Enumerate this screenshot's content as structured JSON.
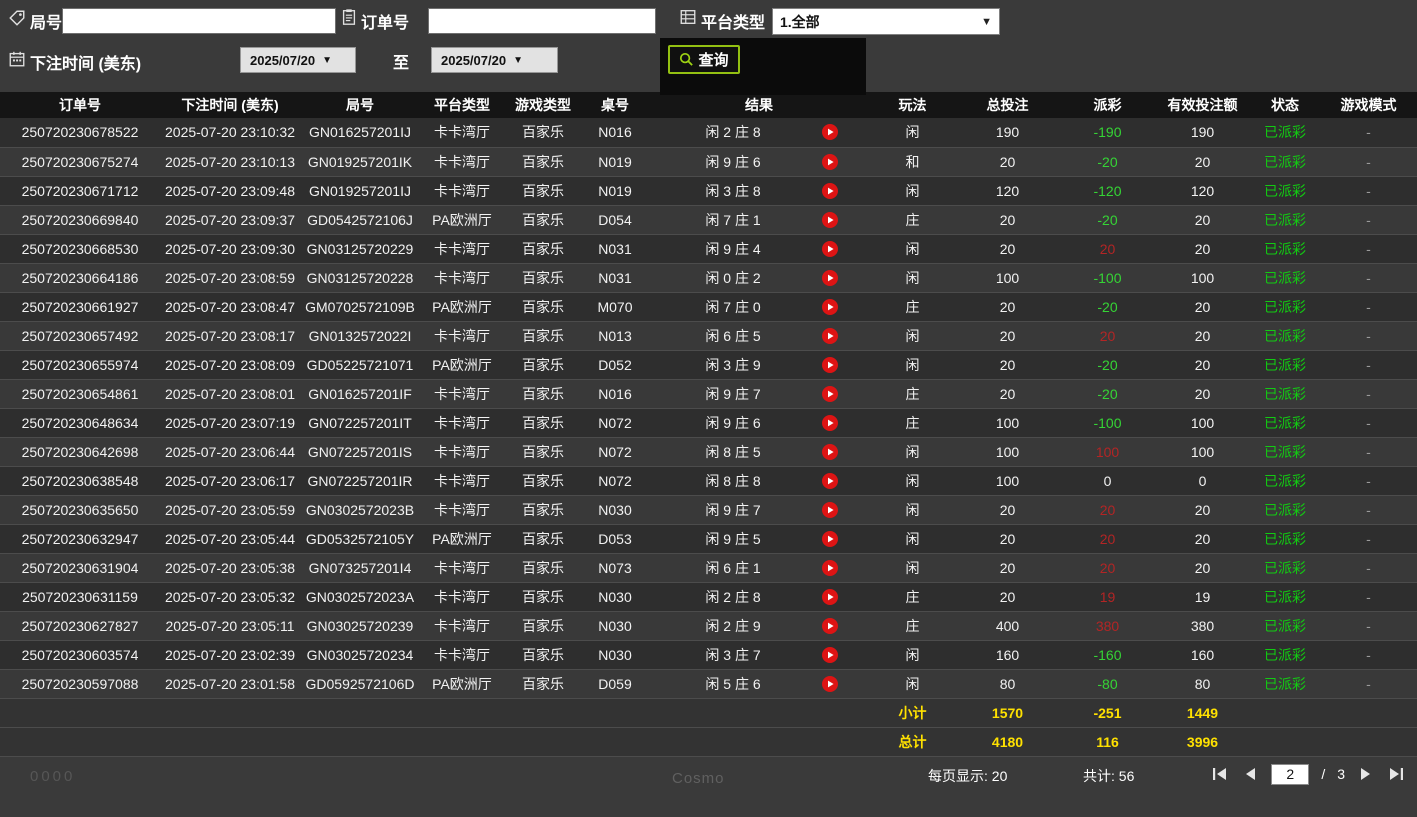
{
  "colors": {
    "background": "#3a3a3a",
    "table_header_bg": "#151515",
    "negative_payout": "#35d435",
    "positive_payout": "#b32525",
    "status_paid": "#12cb12",
    "summary_text": "#ffe100",
    "query_border": "#93c012",
    "play_icon": "#dd1414"
  },
  "filters": {
    "round": {
      "label": "局号",
      "value": "",
      "icon": "tag-icon"
    },
    "order": {
      "label": "订单号",
      "value": "",
      "icon": "clipboard-icon"
    },
    "platform": {
      "label": "平台类型",
      "value": "1.全部",
      "icon": "grid-icon"
    },
    "bet_time": {
      "label": "下注时间 (美东)",
      "icon": "calendar-icon"
    },
    "date_from": "2025/07/20",
    "to_label": "至",
    "date_to": "2025/07/20",
    "query_button": "查询"
  },
  "table": {
    "headers": [
      "订单号",
      "下注时间 (美东)",
      "局号",
      "平台类型",
      "游戏类型",
      "桌号",
      "结果",
      "玩法",
      "总投注",
      "派彩",
      "有效投注额",
      "状态",
      "游戏模式"
    ],
    "rows": [
      {
        "order": "250720230678522",
        "time": "2025-07-20 23:10:32",
        "round": "GN016257201IJ",
        "platform": "卡卡湾厅",
        "game": "百家乐",
        "table_no": "N016",
        "result": "闲 2 庄 8",
        "play": "闲",
        "total": "190",
        "payout": "-190",
        "payout_tone": "neg",
        "valid": "190",
        "status": "已派彩",
        "mode": "-"
      },
      {
        "order": "250720230675274",
        "time": "2025-07-20 23:10:13",
        "round": "GN019257201IK",
        "platform": "卡卡湾厅",
        "game": "百家乐",
        "table_no": "N019",
        "result": "闲 9 庄 6",
        "play": "和",
        "total": "20",
        "payout": "-20",
        "payout_tone": "neg",
        "valid": "20",
        "status": "已派彩",
        "mode": "-"
      },
      {
        "order": "250720230671712",
        "time": "2025-07-20 23:09:48",
        "round": "GN019257201IJ",
        "platform": "卡卡湾厅",
        "game": "百家乐",
        "table_no": "N019",
        "result": "闲 3 庄 8",
        "play": "闲",
        "total": "120",
        "payout": "-120",
        "payout_tone": "neg",
        "valid": "120",
        "status": "已派彩",
        "mode": "-"
      },
      {
        "order": "250720230669840",
        "time": "2025-07-20 23:09:37",
        "round": "GD0542572106J",
        "platform": "PA欧洲厅",
        "game": "百家乐",
        "table_no": "D054",
        "result": "闲 7 庄 1",
        "play": "庄",
        "total": "20",
        "payout": "-20",
        "payout_tone": "neg",
        "valid": "20",
        "status": "已派彩",
        "mode": "-"
      },
      {
        "order": "250720230668530",
        "time": "2025-07-20 23:09:30",
        "round": "GN03125720229",
        "platform": "卡卡湾厅",
        "game": "百家乐",
        "table_no": "N031",
        "result": "闲 9 庄 4",
        "play": "闲",
        "total": "20",
        "payout": "20",
        "payout_tone": "pos",
        "valid": "20",
        "status": "已派彩",
        "mode": "-"
      },
      {
        "order": "250720230664186",
        "time": "2025-07-20 23:08:59",
        "round": "GN03125720228",
        "platform": "卡卡湾厅",
        "game": "百家乐",
        "table_no": "N031",
        "result": "闲 0 庄 2",
        "play": "闲",
        "total": "100",
        "payout": "-100",
        "payout_tone": "neg",
        "valid": "100",
        "status": "已派彩",
        "mode": "-"
      },
      {
        "order": "250720230661927",
        "time": "2025-07-20 23:08:47",
        "round": "GM0702572109B",
        "platform": "PA欧洲厅",
        "game": "百家乐",
        "table_no": "M070",
        "result": "闲 7 庄 0",
        "play": "庄",
        "total": "20",
        "payout": "-20",
        "payout_tone": "neg",
        "valid": "20",
        "status": "已派彩",
        "mode": "-"
      },
      {
        "order": "250720230657492",
        "time": "2025-07-20 23:08:17",
        "round": "GN0132572022I",
        "platform": "卡卡湾厅",
        "game": "百家乐",
        "table_no": "N013",
        "result": "闲 6 庄 5",
        "play": "闲",
        "total": "20",
        "payout": "20",
        "payout_tone": "pos",
        "valid": "20",
        "status": "已派彩",
        "mode": "-"
      },
      {
        "order": "250720230655974",
        "time": "2025-07-20 23:08:09",
        "round": "GD05225721071",
        "platform": "PA欧洲厅",
        "game": "百家乐",
        "table_no": "D052",
        "result": "闲 3 庄 9",
        "play": "闲",
        "total": "20",
        "payout": "-20",
        "payout_tone": "neg",
        "valid": "20",
        "status": "已派彩",
        "mode": "-"
      },
      {
        "order": "250720230654861",
        "time": "2025-07-20 23:08:01",
        "round": "GN016257201IF",
        "platform": "卡卡湾厅",
        "game": "百家乐",
        "table_no": "N016",
        "result": "闲 9 庄 7",
        "play": "庄",
        "total": "20",
        "payout": "-20",
        "payout_tone": "neg",
        "valid": "20",
        "status": "已派彩",
        "mode": "-"
      },
      {
        "order": "250720230648634",
        "time": "2025-07-20 23:07:19",
        "round": "GN072257201IT",
        "platform": "卡卡湾厅",
        "game": "百家乐",
        "table_no": "N072",
        "result": "闲 9 庄 6",
        "play": "庄",
        "total": "100",
        "payout": "-100",
        "payout_tone": "neg",
        "valid": "100",
        "status": "已派彩",
        "mode": "-"
      },
      {
        "order": "250720230642698",
        "time": "2025-07-20 23:06:44",
        "round": "GN072257201IS",
        "platform": "卡卡湾厅",
        "game": "百家乐",
        "table_no": "N072",
        "result": "闲 8 庄 5",
        "play": "闲",
        "total": "100",
        "payout": "100",
        "payout_tone": "pos",
        "valid": "100",
        "status": "已派彩",
        "mode": "-"
      },
      {
        "order": "250720230638548",
        "time": "2025-07-20 23:06:17",
        "round": "GN072257201IR",
        "platform": "卡卡湾厅",
        "game": "百家乐",
        "table_no": "N072",
        "result": "闲 8 庄 8",
        "play": "闲",
        "total": "100",
        "payout": "0",
        "payout_tone": "zero",
        "valid": "0",
        "status": "已派彩",
        "mode": "-"
      },
      {
        "order": "250720230635650",
        "time": "2025-07-20 23:05:59",
        "round": "GN0302572023B",
        "platform": "卡卡湾厅",
        "game": "百家乐",
        "table_no": "N030",
        "result": "闲 9 庄 7",
        "play": "闲",
        "total": "20",
        "payout": "20",
        "payout_tone": "pos",
        "valid": "20",
        "status": "已派彩",
        "mode": "-"
      },
      {
        "order": "250720230632947",
        "time": "2025-07-20 23:05:44",
        "round": "GD0532572105Y",
        "platform": "PA欧洲厅",
        "game": "百家乐",
        "table_no": "D053",
        "result": "闲 9 庄 5",
        "play": "闲",
        "total": "20",
        "payout": "20",
        "payout_tone": "pos",
        "valid": "20",
        "status": "已派彩",
        "mode": "-"
      },
      {
        "order": "250720230631904",
        "time": "2025-07-20 23:05:38",
        "round": "GN073257201I4",
        "platform": "卡卡湾厅",
        "game": "百家乐",
        "table_no": "N073",
        "result": "闲 6 庄 1",
        "play": "闲",
        "total": "20",
        "payout": "20",
        "payout_tone": "pos",
        "valid": "20",
        "status": "已派彩",
        "mode": "-"
      },
      {
        "order": "250720230631159",
        "time": "2025-07-20 23:05:32",
        "round": "GN0302572023A",
        "platform": "卡卡湾厅",
        "game": "百家乐",
        "table_no": "N030",
        "result": "闲 2 庄 8",
        "play": "庄",
        "total": "20",
        "payout": "19",
        "payout_tone": "pos",
        "valid": "19",
        "status": "已派彩",
        "mode": "-"
      },
      {
        "order": "250720230627827",
        "time": "2025-07-20 23:05:11",
        "round": "GN03025720239",
        "platform": "卡卡湾厅",
        "game": "百家乐",
        "table_no": "N030",
        "result": "闲 2 庄 9",
        "play": "庄",
        "total": "400",
        "payout": "380",
        "payout_tone": "pos",
        "valid": "380",
        "status": "已派彩",
        "mode": "-"
      },
      {
        "order": "250720230603574",
        "time": "2025-07-20 23:02:39",
        "round": "GN03025720234",
        "platform": "卡卡湾厅",
        "game": "百家乐",
        "table_no": "N030",
        "result": "闲 3 庄 7",
        "play": "闲",
        "total": "160",
        "payout": "-160",
        "payout_tone": "neg",
        "valid": "160",
        "status": "已派彩",
        "mode": "-"
      },
      {
        "order": "250720230597088",
        "time": "2025-07-20 23:01:58",
        "round": "GD0592572106D",
        "platform": "PA欧洲厅",
        "game": "百家乐",
        "table_no": "D059",
        "result": "闲 5 庄 6",
        "play": "闲",
        "total": "80",
        "payout": "-80",
        "payout_tone": "neg",
        "valid": "80",
        "status": "已派彩",
        "mode": "-"
      }
    ],
    "subtotal": {
      "label": "小计",
      "total_bet": "1570",
      "payout": "-251",
      "valid_bet": "1449"
    },
    "grand_total": {
      "label": "总计",
      "total_bet": "4180",
      "payout": "116",
      "valid_bet": "3996"
    }
  },
  "footer": {
    "per_page_label": "每页显示:",
    "per_page_value": "20",
    "total_label": "共计:",
    "total_value": "56",
    "current_page": "2",
    "page_separator": "/",
    "total_pages": "3"
  },
  "artifacts": {
    "bottom_left_text": "0000",
    "bottom_center_text": "Cosmo"
  }
}
